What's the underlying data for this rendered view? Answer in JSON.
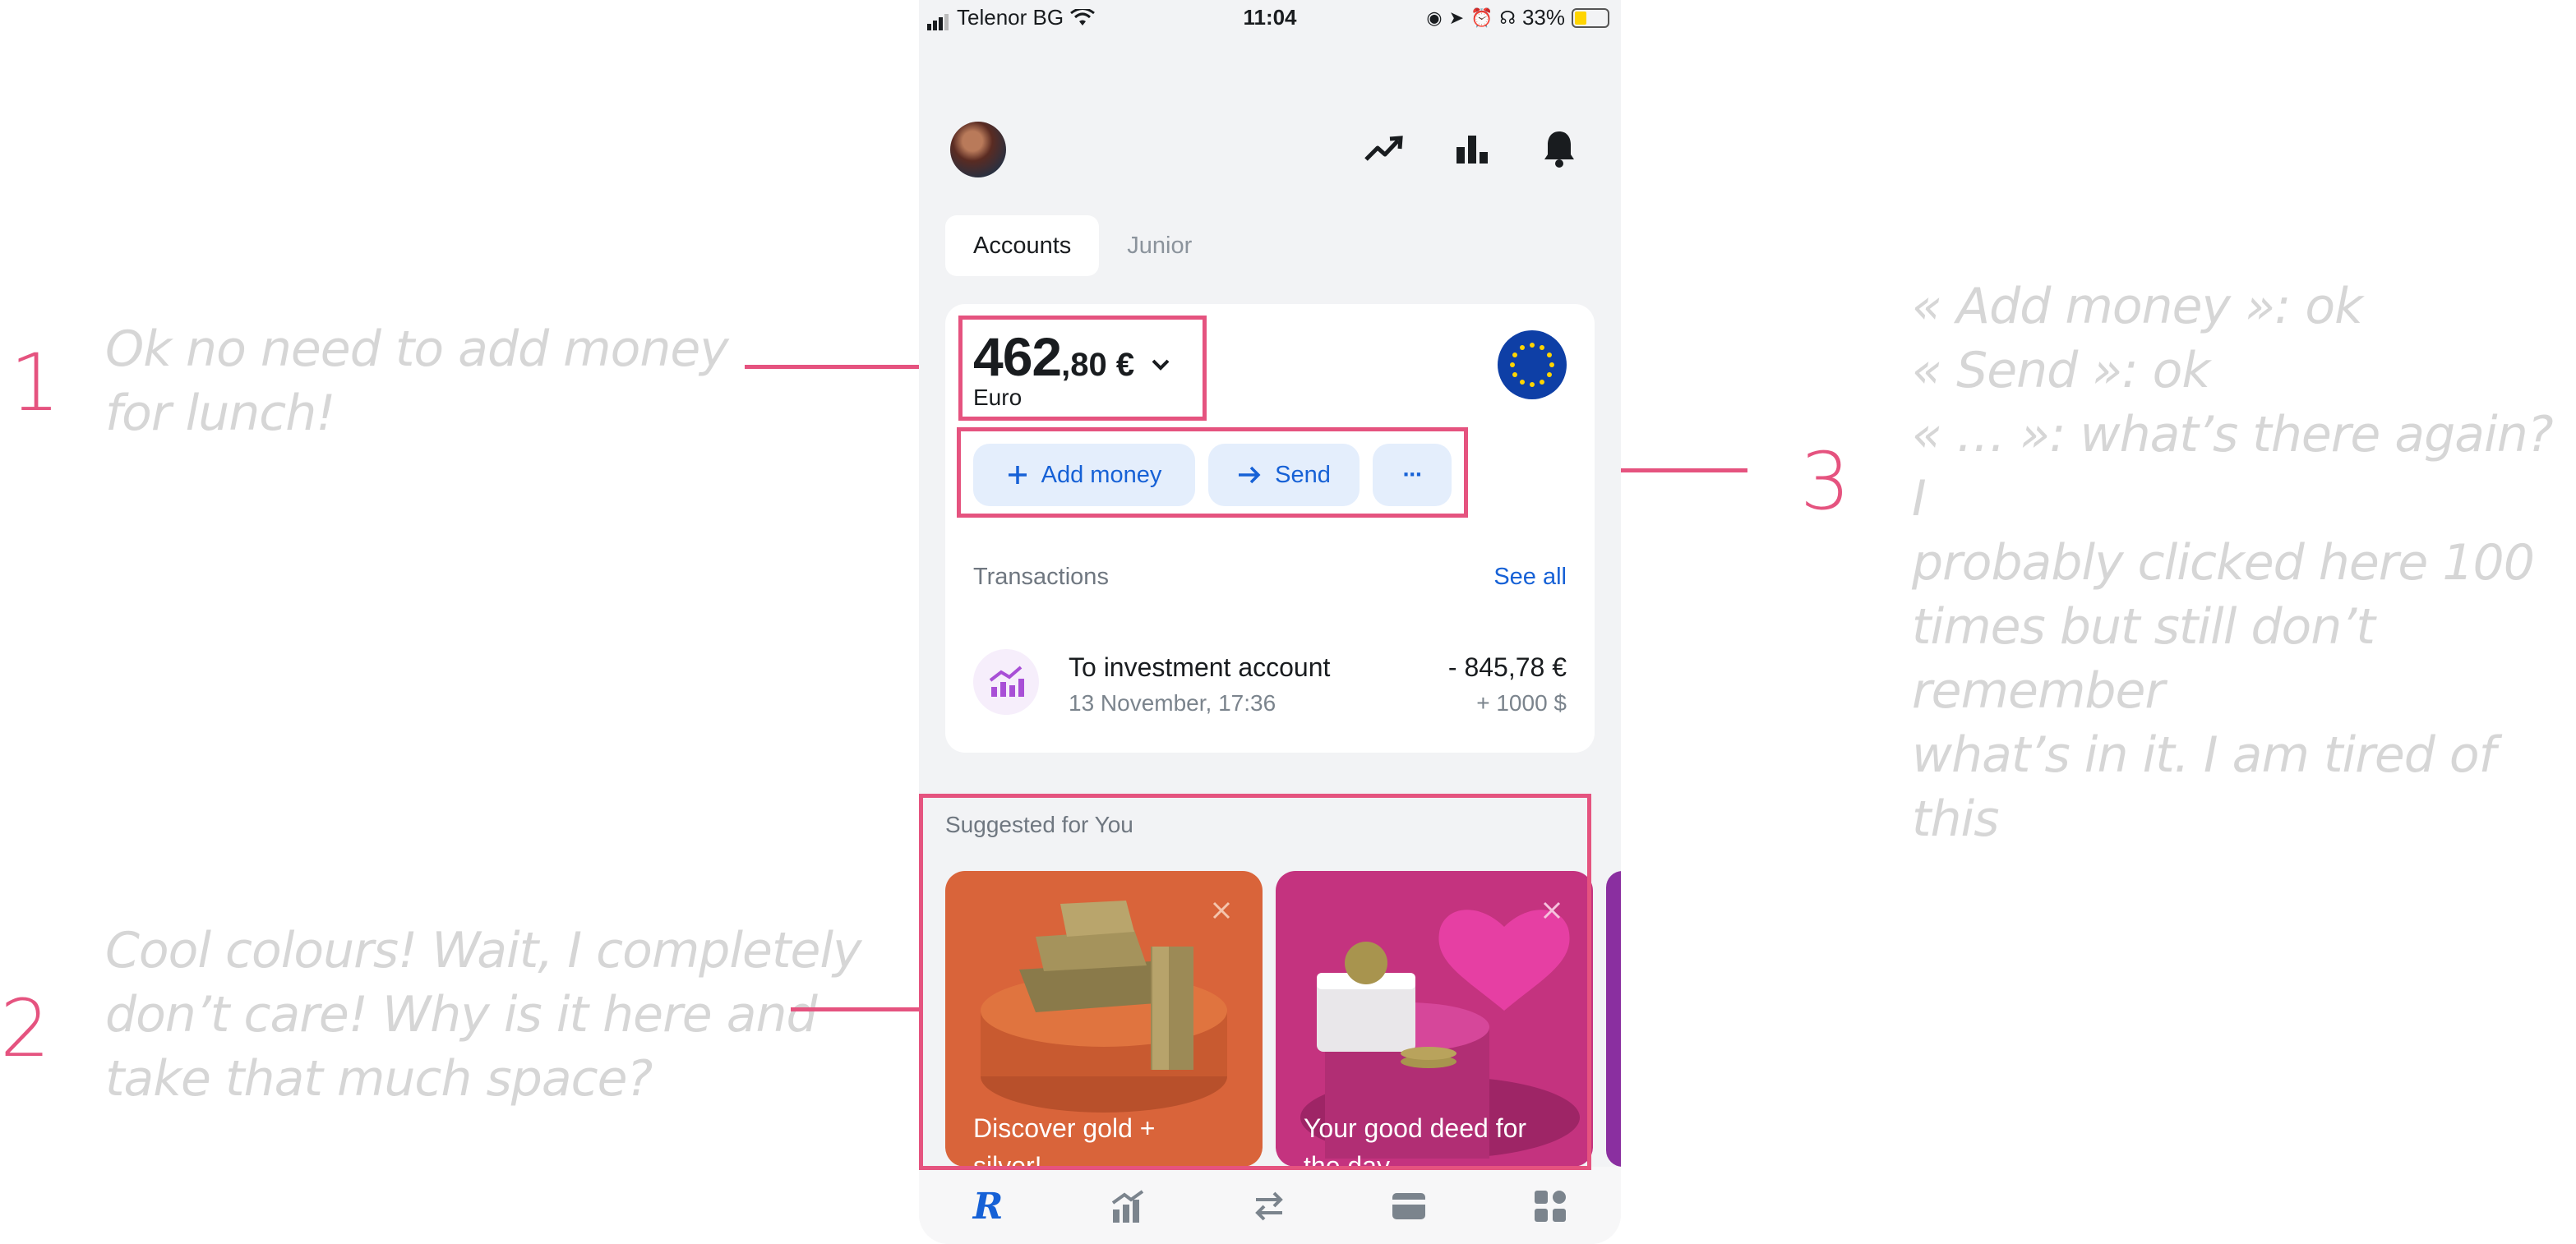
{
  "status_bar": {
    "carrier": "Telenor BG",
    "time": "11:04",
    "battery": "33%"
  },
  "tabs": [
    {
      "label": "Accounts",
      "active": true
    },
    {
      "label": "Junior",
      "active": false
    }
  ],
  "account": {
    "balance_integer": "462",
    "balance_decimal": ",80 €",
    "currency": "Euro",
    "actions": {
      "add_money": "Add money",
      "send": "Send",
      "more": "···"
    }
  },
  "transactions": {
    "header": "Transactions",
    "see_all": "See all",
    "items": [
      {
        "title": "To investment account",
        "date": "13 November, 17:36",
        "amount": "- 845,78 €",
        "secondary": "+ 1000 $"
      }
    ]
  },
  "suggested": {
    "title": "Suggested for You",
    "cards": [
      {
        "label": "Discover gold +\nsilver!",
        "color": "#d9643a"
      },
      {
        "label": "Your good deed for\nthe day",
        "color": "#c4337f"
      }
    ]
  },
  "annotations": {
    "note1": {
      "number": "1",
      "text": "Ok no need to add money\nfor lunch!"
    },
    "note2": {
      "number": "2",
      "text": "Cool colours! Wait, I completely\ndon’t care! Why is it here and\ntake that much space?"
    },
    "note3": {
      "number": "3",
      "text": "« Add money »: ok\n« Send »: ok\n« … »: what’s there again? I\nprobably clicked here 100\ntimes but still don’t remember\nwhat’s in it. I am tired of this"
    }
  },
  "colors": {
    "annotation_accent": "#e5537f",
    "link_blue": "#1661d6",
    "app_bg": "#f2f3f5"
  }
}
